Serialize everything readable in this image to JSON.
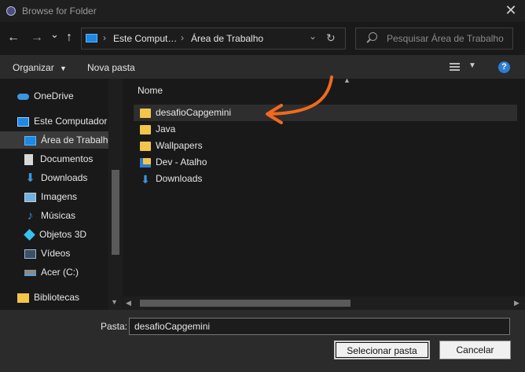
{
  "window": {
    "title": "Browse for Folder",
    "close_glyph": "✕"
  },
  "navigation": {
    "back_glyph": "←",
    "forward_glyph": "→",
    "recent_glyph": "⌄",
    "up_glyph": "↑",
    "breadcrumb": [
      "Este Comput…",
      "Área de Trabalho"
    ],
    "refresh_glyph": "↻",
    "search_placeholder": "Pesquisar Área de Trabalho"
  },
  "toolbar": {
    "organize_label": "Organizar",
    "new_folder_label": "Nova pasta",
    "help_glyph": "?"
  },
  "tree": [
    {
      "label": "OneDrive",
      "icon": "onedrive-icon",
      "color": "#3a96dd"
    },
    {
      "label": "Este Computador",
      "icon": "computer-icon",
      "color": "#4fa3e0"
    },
    {
      "label": "Área de Trabalho",
      "icon": "desktop-icon",
      "color": "#1e88e5",
      "selected": true
    },
    {
      "label": "Documentos",
      "icon": "documents-icon",
      "color": "#d8d8d8"
    },
    {
      "label": "Downloads",
      "icon": "downloads-icon",
      "color": "#3a96dd"
    },
    {
      "label": "Imagens",
      "icon": "pictures-icon",
      "color": "#6fb1e6"
    },
    {
      "label": "Músicas",
      "icon": "music-icon",
      "color": "#3a96dd"
    },
    {
      "label": "Objetos 3D",
      "icon": "objects-3d-icon",
      "color": "#35c3f0"
    },
    {
      "label": "Vídeos",
      "icon": "videos-icon",
      "color": "#9bb7d4"
    },
    {
      "label": "Acer (C:)",
      "icon": "drive-icon",
      "color": "#8a8a8a"
    },
    {
      "label": "Bibliotecas",
      "icon": "libraries-icon",
      "color": "#f3c64b"
    }
  ],
  "list": {
    "column_header": "Nome",
    "items": [
      {
        "name": "desafioCapgemini",
        "icon": "folder-icon",
        "selected": true
      },
      {
        "name": "Java",
        "icon": "folder-icon"
      },
      {
        "name": "Wallpapers",
        "icon": "folder-icon"
      },
      {
        "name": "Dev - Atalho",
        "icon": "folder-shortcut-icon"
      },
      {
        "name": "Downloads",
        "icon": "downloads-shortcut-icon"
      }
    ]
  },
  "footer": {
    "folder_label": "Pasta:",
    "folder_value": "desafioCapgemini",
    "select_button": "Selecionar pasta",
    "cancel_button": "Cancelar"
  },
  "colors": {
    "accent": "#2d7dd2",
    "annotation_arrow": "#f06a1d",
    "folder": "#f3c64b"
  }
}
